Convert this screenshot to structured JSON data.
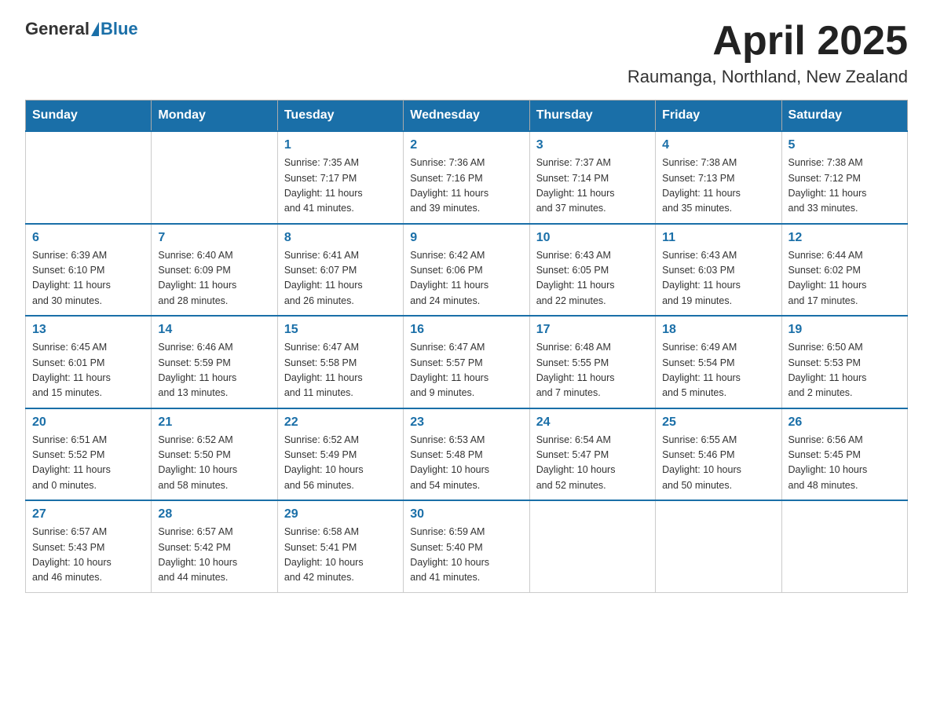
{
  "header": {
    "logo_general": "General",
    "logo_blue": "Blue",
    "month_title": "April 2025",
    "location": "Raumanga, Northland, New Zealand"
  },
  "weekdays": [
    "Sunday",
    "Monday",
    "Tuesday",
    "Wednesday",
    "Thursday",
    "Friday",
    "Saturday"
  ],
  "weeks": [
    [
      {
        "day": "",
        "info": ""
      },
      {
        "day": "",
        "info": ""
      },
      {
        "day": "1",
        "info": "Sunrise: 7:35 AM\nSunset: 7:17 PM\nDaylight: 11 hours\nand 41 minutes."
      },
      {
        "day": "2",
        "info": "Sunrise: 7:36 AM\nSunset: 7:16 PM\nDaylight: 11 hours\nand 39 minutes."
      },
      {
        "day": "3",
        "info": "Sunrise: 7:37 AM\nSunset: 7:14 PM\nDaylight: 11 hours\nand 37 minutes."
      },
      {
        "day": "4",
        "info": "Sunrise: 7:38 AM\nSunset: 7:13 PM\nDaylight: 11 hours\nand 35 minutes."
      },
      {
        "day": "5",
        "info": "Sunrise: 7:38 AM\nSunset: 7:12 PM\nDaylight: 11 hours\nand 33 minutes."
      }
    ],
    [
      {
        "day": "6",
        "info": "Sunrise: 6:39 AM\nSunset: 6:10 PM\nDaylight: 11 hours\nand 30 minutes."
      },
      {
        "day": "7",
        "info": "Sunrise: 6:40 AM\nSunset: 6:09 PM\nDaylight: 11 hours\nand 28 minutes."
      },
      {
        "day": "8",
        "info": "Sunrise: 6:41 AM\nSunset: 6:07 PM\nDaylight: 11 hours\nand 26 minutes."
      },
      {
        "day": "9",
        "info": "Sunrise: 6:42 AM\nSunset: 6:06 PM\nDaylight: 11 hours\nand 24 minutes."
      },
      {
        "day": "10",
        "info": "Sunrise: 6:43 AM\nSunset: 6:05 PM\nDaylight: 11 hours\nand 22 minutes."
      },
      {
        "day": "11",
        "info": "Sunrise: 6:43 AM\nSunset: 6:03 PM\nDaylight: 11 hours\nand 19 minutes."
      },
      {
        "day": "12",
        "info": "Sunrise: 6:44 AM\nSunset: 6:02 PM\nDaylight: 11 hours\nand 17 minutes."
      }
    ],
    [
      {
        "day": "13",
        "info": "Sunrise: 6:45 AM\nSunset: 6:01 PM\nDaylight: 11 hours\nand 15 minutes."
      },
      {
        "day": "14",
        "info": "Sunrise: 6:46 AM\nSunset: 5:59 PM\nDaylight: 11 hours\nand 13 minutes."
      },
      {
        "day": "15",
        "info": "Sunrise: 6:47 AM\nSunset: 5:58 PM\nDaylight: 11 hours\nand 11 minutes."
      },
      {
        "day": "16",
        "info": "Sunrise: 6:47 AM\nSunset: 5:57 PM\nDaylight: 11 hours\nand 9 minutes."
      },
      {
        "day": "17",
        "info": "Sunrise: 6:48 AM\nSunset: 5:55 PM\nDaylight: 11 hours\nand 7 minutes."
      },
      {
        "day": "18",
        "info": "Sunrise: 6:49 AM\nSunset: 5:54 PM\nDaylight: 11 hours\nand 5 minutes."
      },
      {
        "day": "19",
        "info": "Sunrise: 6:50 AM\nSunset: 5:53 PM\nDaylight: 11 hours\nand 2 minutes."
      }
    ],
    [
      {
        "day": "20",
        "info": "Sunrise: 6:51 AM\nSunset: 5:52 PM\nDaylight: 11 hours\nand 0 minutes."
      },
      {
        "day": "21",
        "info": "Sunrise: 6:52 AM\nSunset: 5:50 PM\nDaylight: 10 hours\nand 58 minutes."
      },
      {
        "day": "22",
        "info": "Sunrise: 6:52 AM\nSunset: 5:49 PM\nDaylight: 10 hours\nand 56 minutes."
      },
      {
        "day": "23",
        "info": "Sunrise: 6:53 AM\nSunset: 5:48 PM\nDaylight: 10 hours\nand 54 minutes."
      },
      {
        "day": "24",
        "info": "Sunrise: 6:54 AM\nSunset: 5:47 PM\nDaylight: 10 hours\nand 52 minutes."
      },
      {
        "day": "25",
        "info": "Sunrise: 6:55 AM\nSunset: 5:46 PM\nDaylight: 10 hours\nand 50 minutes."
      },
      {
        "day": "26",
        "info": "Sunrise: 6:56 AM\nSunset: 5:45 PM\nDaylight: 10 hours\nand 48 minutes."
      }
    ],
    [
      {
        "day": "27",
        "info": "Sunrise: 6:57 AM\nSunset: 5:43 PM\nDaylight: 10 hours\nand 46 minutes."
      },
      {
        "day": "28",
        "info": "Sunrise: 6:57 AM\nSunset: 5:42 PM\nDaylight: 10 hours\nand 44 minutes."
      },
      {
        "day": "29",
        "info": "Sunrise: 6:58 AM\nSunset: 5:41 PM\nDaylight: 10 hours\nand 42 minutes."
      },
      {
        "day": "30",
        "info": "Sunrise: 6:59 AM\nSunset: 5:40 PM\nDaylight: 10 hours\nand 41 minutes."
      },
      {
        "day": "",
        "info": ""
      },
      {
        "day": "",
        "info": ""
      },
      {
        "day": "",
        "info": ""
      }
    ]
  ]
}
